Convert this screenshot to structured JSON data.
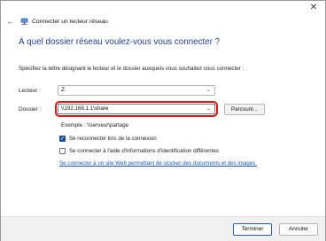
{
  "window": {
    "title": "Connecter un lecteur réseau",
    "close_glyph": "✕",
    "back_glyph": "←"
  },
  "heading": "À quel dossier réseau voulez-vous vous connecter ?",
  "intro": "Spécifiez la lettre désignant le lecteur et le dossier auxquels vous souhaitez vous connecter :",
  "drive": {
    "label": "Lecteur :",
    "value": "Z:",
    "caret": "⌄"
  },
  "folder": {
    "label": "Dossier :",
    "value": "\\\\192.168.1.1\\share",
    "caret": "⌄",
    "browse_label": "Parcourir..."
  },
  "example": "Exemple : \\\\serveur\\partage",
  "options": {
    "reconnect": {
      "label": "Se reconnecter lors de la connexion",
      "checked": true
    },
    "other_credentials": {
      "label": "Se connecter à l'aide d'informations d'identification différentes",
      "checked": false
    }
  },
  "link": "Se connecter à un site Web permettant de stocker des documents et des images.",
  "buttons": {
    "finish": "Terminer",
    "cancel": "Annuler"
  },
  "colors": {
    "heading": "#1e3f8a",
    "highlight": "#d11a1a",
    "checkbox": "#1f4e9c",
    "link": "#1a56b8"
  }
}
